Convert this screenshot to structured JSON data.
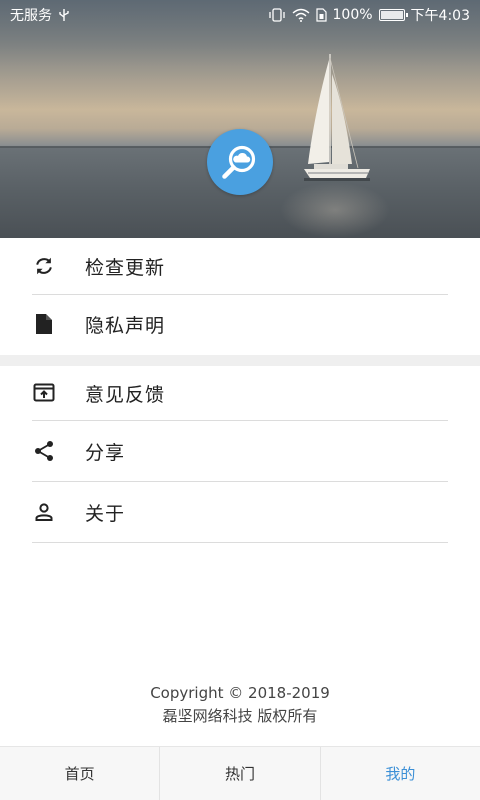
{
  "status_bar": {
    "carrier": "无服务",
    "battery": "100%",
    "time": "下午4:03",
    "icons": [
      "usb-icon",
      "vibrate-icon",
      "wifi-icon",
      "sim-icon",
      "battery-icon"
    ]
  },
  "header": {
    "logo_icon": "cloud-search-icon",
    "accent_color": "#4aa0e0"
  },
  "menu": {
    "group1": [
      {
        "icon": "refresh-icon",
        "label": "检查更新"
      },
      {
        "icon": "document-icon",
        "label": "隐私声明"
      }
    ],
    "group2": [
      {
        "icon": "feedback-icon",
        "label": "意见反馈"
      },
      {
        "icon": "share-icon",
        "label": "分享"
      },
      {
        "icon": "person-icon",
        "label": "关于"
      }
    ]
  },
  "footer": {
    "copyright": "Copyright © 2018-2019",
    "company": "磊坚网络科技 版权所有"
  },
  "tabs": [
    {
      "label": "首页",
      "active": false
    },
    {
      "label": "热门",
      "active": false
    },
    {
      "label": "我的",
      "active": true,
      "color": "#3b8fd6"
    }
  ]
}
